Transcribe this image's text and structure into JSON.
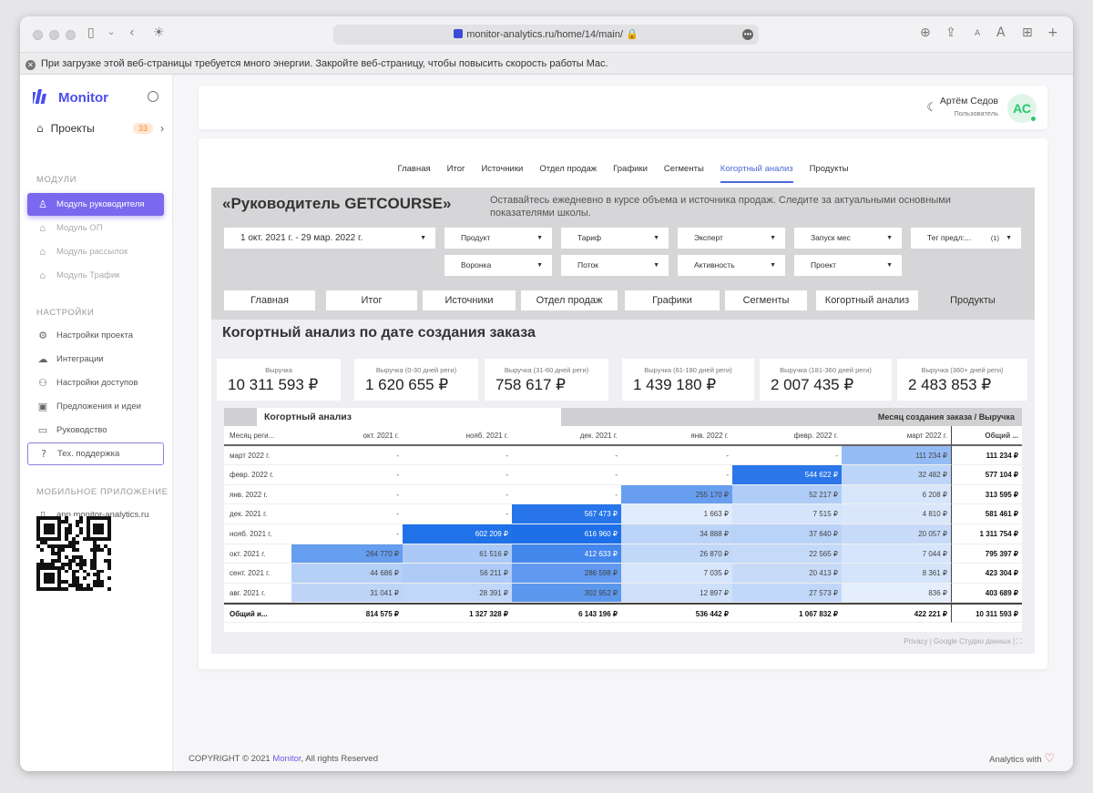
{
  "browser": {
    "url": "monitor-analytics.ru/home/14/main/",
    "energy_warning": "При загрузке этой веб-страницы требуется много энергии. Закройте веб-страницу, чтобы повысить скорость работы Mac."
  },
  "sidebar": {
    "logo": "Monitor",
    "projects_label": "Проекты",
    "projects_count": "33",
    "modules_title": "МОДУЛИ",
    "modules": [
      {
        "label": "Модуль руководителя",
        "icon": "user-icon"
      },
      {
        "label": "Модуль ОП",
        "icon": "lock-icon"
      },
      {
        "label": "Модуль рассылок",
        "icon": "lock-icon"
      },
      {
        "label": "Модуль Трафик",
        "icon": "lock-icon"
      }
    ],
    "settings_title": "НАСТРОЙКИ",
    "settings": [
      {
        "label": "Настройки проекта",
        "icon": "gear-icon"
      },
      {
        "label": "Интеграции",
        "icon": "cloud-icon"
      },
      {
        "label": "Настройки доступов",
        "icon": "users-icon"
      },
      {
        "label": "Предложения и идеи",
        "icon": "lightbulb-icon"
      },
      {
        "label": "Руководство",
        "icon": "monitor-icon"
      },
      {
        "label": "Тех. поддержка",
        "icon": "help-icon"
      }
    ],
    "mobile_title": "МОБИЛЬНОЕ ПРИЛОЖЕНИЕ",
    "mobile_link": "app.monitor-analytics.ru"
  },
  "header": {
    "user_name": "Артём Седов",
    "user_role": "Пользователь",
    "avatar_initials": "АС"
  },
  "tabs": [
    "Главная",
    "Итог",
    "Источники",
    "Отдел продаж",
    "Графики",
    "Сегменты",
    "Когортный анализ",
    "Продукты"
  ],
  "active_tab": "Когортный анализ",
  "report": {
    "title": "«Руководитель GETCOURSE»",
    "subtitle": "Оставайтесь ежедневно в курсе объема и источника продаж. Следите за актуальными основными показателями школы.",
    "date_range": "1 окт. 2021 г. - 29 мар. 2022 г.",
    "filters_row1": [
      "Продукт",
      "Тариф",
      "Эксперт",
      "Запуск мес",
      "Тег предл:..."
    ],
    "filter_count": "(1)",
    "filters_row2": [
      "Воронка",
      "Поток",
      "Активность",
      "Проект"
    ],
    "inner_tabs": [
      "Главная",
      "Итог",
      "Источники",
      "Отдел продаж",
      "Графики",
      "Сегменты",
      "Когортный анализ",
      "Продукты"
    ],
    "section_title": "Когортный анализ по дате создания заказа",
    "kpis": [
      {
        "label": "Выручка",
        "value": "10 311 593 ₽"
      },
      {
        "label": "Выручка (0-30 дней реги)",
        "value": "1 620 655 ₽"
      },
      {
        "label": "Выручка (31-60 дней реги)",
        "value": "758 617 ₽"
      },
      {
        "label": "Выручка (61-180 дней реги)",
        "value": "1 439 180 ₽"
      },
      {
        "label": "Выручка (181-360 дней реги)",
        "value": "2 007 435 ₽"
      },
      {
        "label": "Выручка (360+ дней реги)",
        "value": "2 483 853 ₽"
      }
    ],
    "table": {
      "title": "Когортный анализ",
      "dim_header": "Месяц создания заказа / Выручка",
      "first_col": "Месяц реги...",
      "columns": [
        "окт. 2021 г.",
        "нояб. 2021 г.",
        "дек. 2021 г.",
        "янв. 2022 г.",
        "февр. 2022 г.",
        "март 2022 г."
      ],
      "total_col": "Общий ...",
      "rows": [
        {
          "label": "март 2022 г.",
          "cells": [
            "-",
            "-",
            "-",
            "-",
            "-",
            "111 234 ₽"
          ],
          "total": "111 234 ₽"
        },
        {
          "label": "февр. 2022 г.",
          "cells": [
            "-",
            "-",
            "-",
            "-",
            "544 622 ₽",
            "32 482 ₽"
          ],
          "total": "577 104 ₽"
        },
        {
          "label": "янв. 2022 г.",
          "cells": [
            "-",
            "-",
            "-",
            "255 170 ₽",
            "52 217 ₽",
            "6 208 ₽"
          ],
          "total": "313 595 ₽"
        },
        {
          "label": "дек. 2021 г.",
          "cells": [
            "-",
            "-",
            "567 473 ₽",
            "1 663 ₽",
            "7 515 ₽",
            "4 810 ₽"
          ],
          "total": "581 461 ₽"
        },
        {
          "label": "нояб. 2021 г.",
          "cells": [
            "-",
            "602 209 ₽",
            "616 960 ₽",
            "34 888 ₽",
            "37 640 ₽",
            "20 057 ₽"
          ],
          "total": "1 311 754 ₽"
        },
        {
          "label": "окт. 2021 г.",
          "cells": [
            "264 770 ₽",
            "61 516 ₽",
            "412 633 ₽",
            "26 870 ₽",
            "22 565 ₽",
            "7 044 ₽"
          ],
          "total": "795 397 ₽"
        },
        {
          "label": "сент. 2021 г.",
          "cells": [
            "44 686 ₽",
            "56 211 ₽",
            "286 598 ₽",
            "7 035 ₽",
            "20 413 ₽",
            "8 361 ₽"
          ],
          "total": "423 304 ₽"
        },
        {
          "label": "авг. 2021 г.",
          "cells": [
            "31 041 ₽",
            "28 391 ₽",
            "302 952 ₽",
            "12 897 ₽",
            "27 573 ₽",
            "836 ₽"
          ],
          "total": "403 689 ₽"
        }
      ],
      "footer": {
        "label": "Общий и...",
        "cells": [
          "814 575 ₽",
          "1 327 328 ₽",
          "6 143 196 ₽",
          "536 442 ₽",
          "1 067 832 ₽",
          "422 221 ₽"
        ],
        "total": "10 311 593 ₽"
      }
    },
    "footer_links": "Privacy | Google Студио данных |"
  },
  "footer": {
    "copyright_prefix": "COPYRIGHT © 2021 ",
    "copyright_brand": "Monitor",
    "copyright_suffix": ", All rights Reserved",
    "analytics_with": "Analytics with"
  },
  "colors": {
    "accent": "#7b68ee",
    "brand": "#4b4ef0",
    "heat_max": "#1e6fe8",
    "success": "#28c76f"
  }
}
